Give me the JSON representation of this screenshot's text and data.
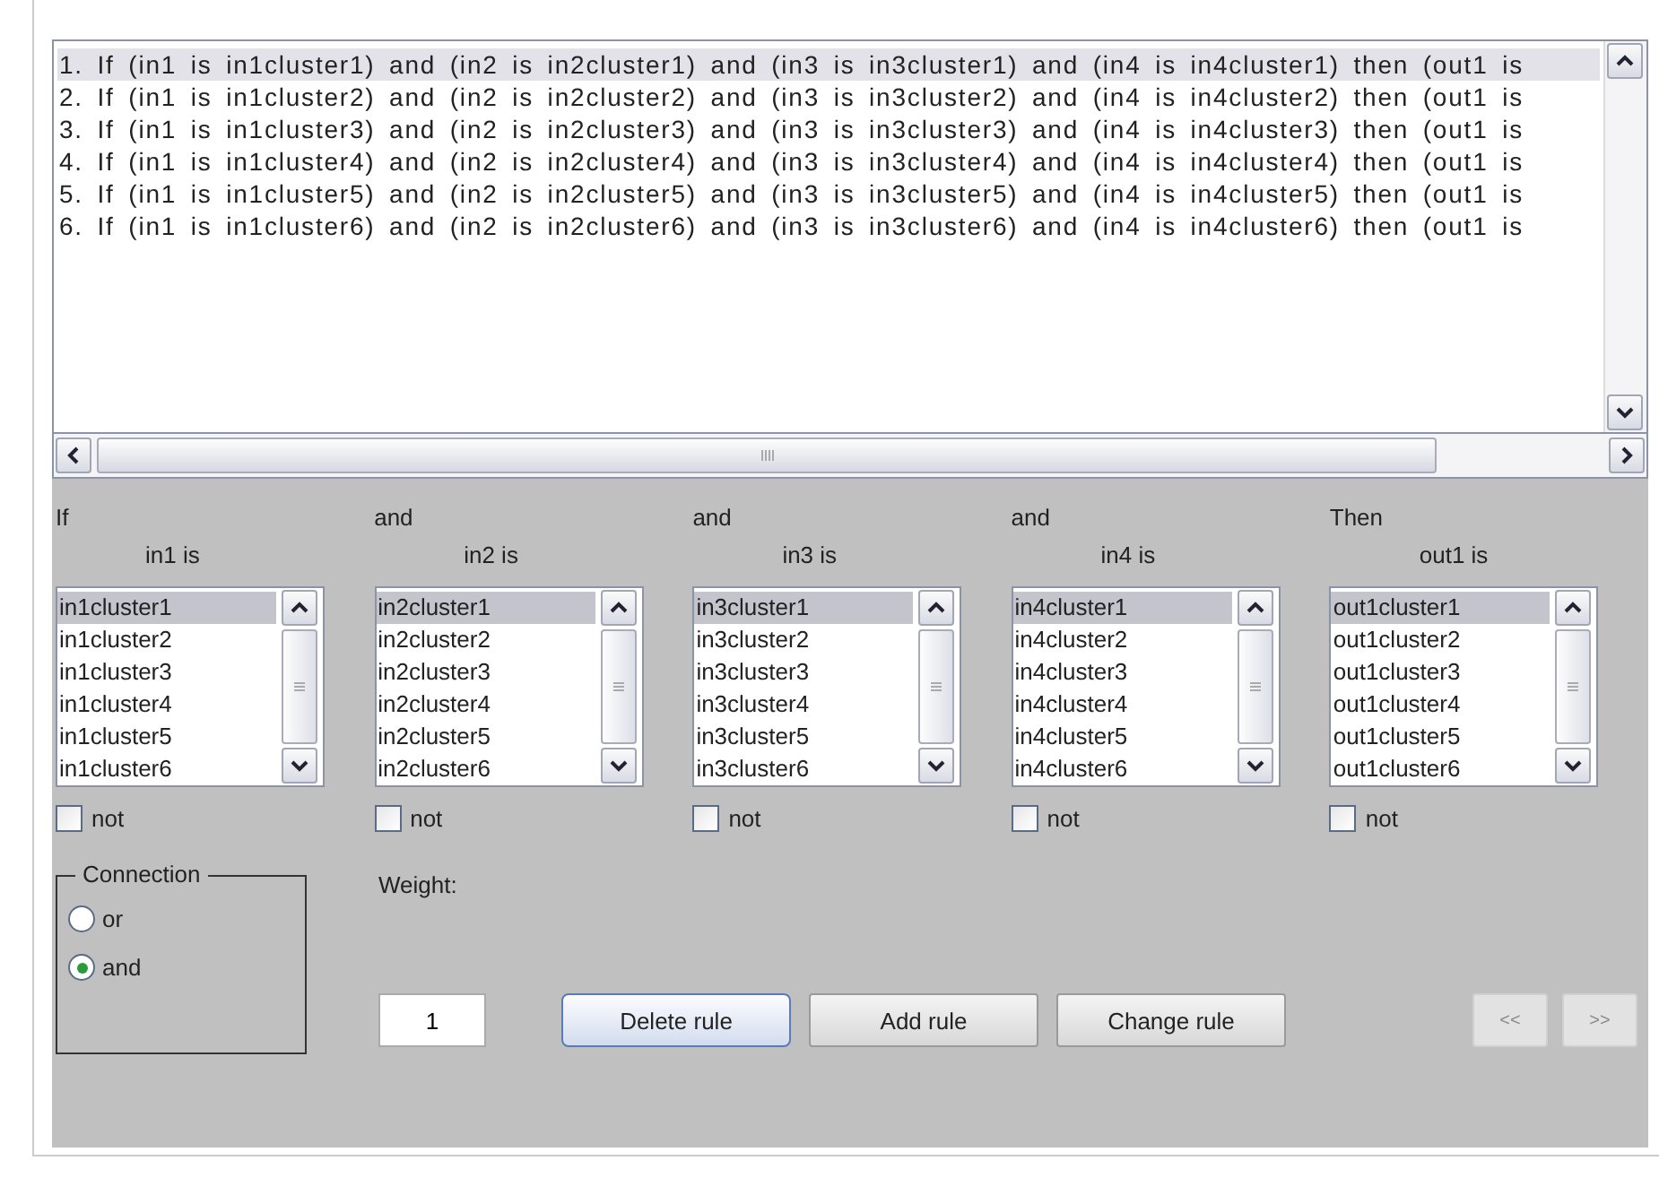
{
  "rules": [
    {
      "text": "1. If (in1 is in1cluster1) and (in2 is in2cluster1) and (in3 is in3cluster1) and (in4 is in4cluster1) then (out1 is",
      "selected": true
    },
    {
      "text": "2. If (in1 is in1cluster2) and (in2 is in2cluster2) and (in3 is in3cluster2) and (in4 is in4cluster2) then (out1 is",
      "selected": false
    },
    {
      "text": "3. If (in1 is in1cluster3) and (in2 is in2cluster3) and (in3 is in3cluster3) and (in4 is in4cluster3) then (out1 is",
      "selected": false
    },
    {
      "text": "4. If (in1 is in1cluster4) and (in2 is in2cluster4) and (in3 is in3cluster4) and (in4 is in4cluster4) then (out1 is",
      "selected": false
    },
    {
      "text": "5. If (in1 is in1cluster5) and (in2 is in2cluster5) and (in3 is in3cluster5) and (in4 is in4cluster5) then (out1 is",
      "selected": false
    },
    {
      "text": "6. If (in1 is in1cluster6) and (in2 is in2cluster6) and (in3 is in3cluster6) and (in4 is in4cluster6) then (out1 is",
      "selected": false
    }
  ],
  "columns": [
    {
      "connector": "If",
      "label": "in1 is",
      "items": [
        {
          "text": "in1cluster1",
          "selected": true
        },
        {
          "text": "in1cluster2",
          "selected": false
        },
        {
          "text": "in1cluster3",
          "selected": false
        },
        {
          "text": "in1cluster4",
          "selected": false
        },
        {
          "text": "in1cluster5",
          "selected": false
        },
        {
          "text": "in1cluster6",
          "selected": false
        }
      ],
      "not": {
        "label": "not",
        "checked": false
      }
    },
    {
      "connector": "and",
      "label": "in2 is",
      "items": [
        {
          "text": "in2cluster1",
          "selected": true
        },
        {
          "text": "in2cluster2",
          "selected": false
        },
        {
          "text": "in2cluster3",
          "selected": false
        },
        {
          "text": "in2cluster4",
          "selected": false
        },
        {
          "text": "in2cluster5",
          "selected": false
        },
        {
          "text": "in2cluster6",
          "selected": false
        }
      ],
      "not": {
        "label": "not",
        "checked": false
      }
    },
    {
      "connector": "and",
      "label": "in3 is",
      "items": [
        {
          "text": "in3cluster1",
          "selected": true
        },
        {
          "text": "in3cluster2",
          "selected": false
        },
        {
          "text": "in3cluster3",
          "selected": false
        },
        {
          "text": "in3cluster4",
          "selected": false
        },
        {
          "text": "in3cluster5",
          "selected": false
        },
        {
          "text": "in3cluster6",
          "selected": false
        }
      ],
      "not": {
        "label": "not",
        "checked": false
      }
    },
    {
      "connector": "and",
      "label": "in4 is",
      "items": [
        {
          "text": "in4cluster1",
          "selected": true
        },
        {
          "text": "in4cluster2",
          "selected": false
        },
        {
          "text": "in4cluster3",
          "selected": false
        },
        {
          "text": "in4cluster4",
          "selected": false
        },
        {
          "text": "in4cluster5",
          "selected": false
        },
        {
          "text": "in4cluster6",
          "selected": false
        }
      ],
      "not": {
        "label": "not",
        "checked": false
      }
    },
    {
      "connector": "Then",
      "label": "out1 is",
      "items": [
        {
          "text": "out1cluster1",
          "selected": true
        },
        {
          "text": "out1cluster2",
          "selected": false
        },
        {
          "text": "out1cluster3",
          "selected": false
        },
        {
          "text": "out1cluster4",
          "selected": false
        },
        {
          "text": "out1cluster5",
          "selected": false
        },
        {
          "text": "out1cluster6",
          "selected": false
        }
      ],
      "not": {
        "label": "not",
        "checked": false
      }
    }
  ],
  "connection": {
    "title": "Connection",
    "options": [
      {
        "label": "or",
        "selected": false
      },
      {
        "label": "and",
        "selected": true
      }
    ]
  },
  "weight": {
    "label": "Weight:",
    "value": "1"
  },
  "buttons": [
    {
      "label": "Delete rule",
      "focused": true
    },
    {
      "label": "Add rule",
      "focused": false
    },
    {
      "label": "Change rule",
      "focused": false
    }
  ],
  "nav_buttons": [
    {
      "label": "<<",
      "disabled": true
    },
    {
      "label": ">>",
      "disabled": true
    }
  ]
}
